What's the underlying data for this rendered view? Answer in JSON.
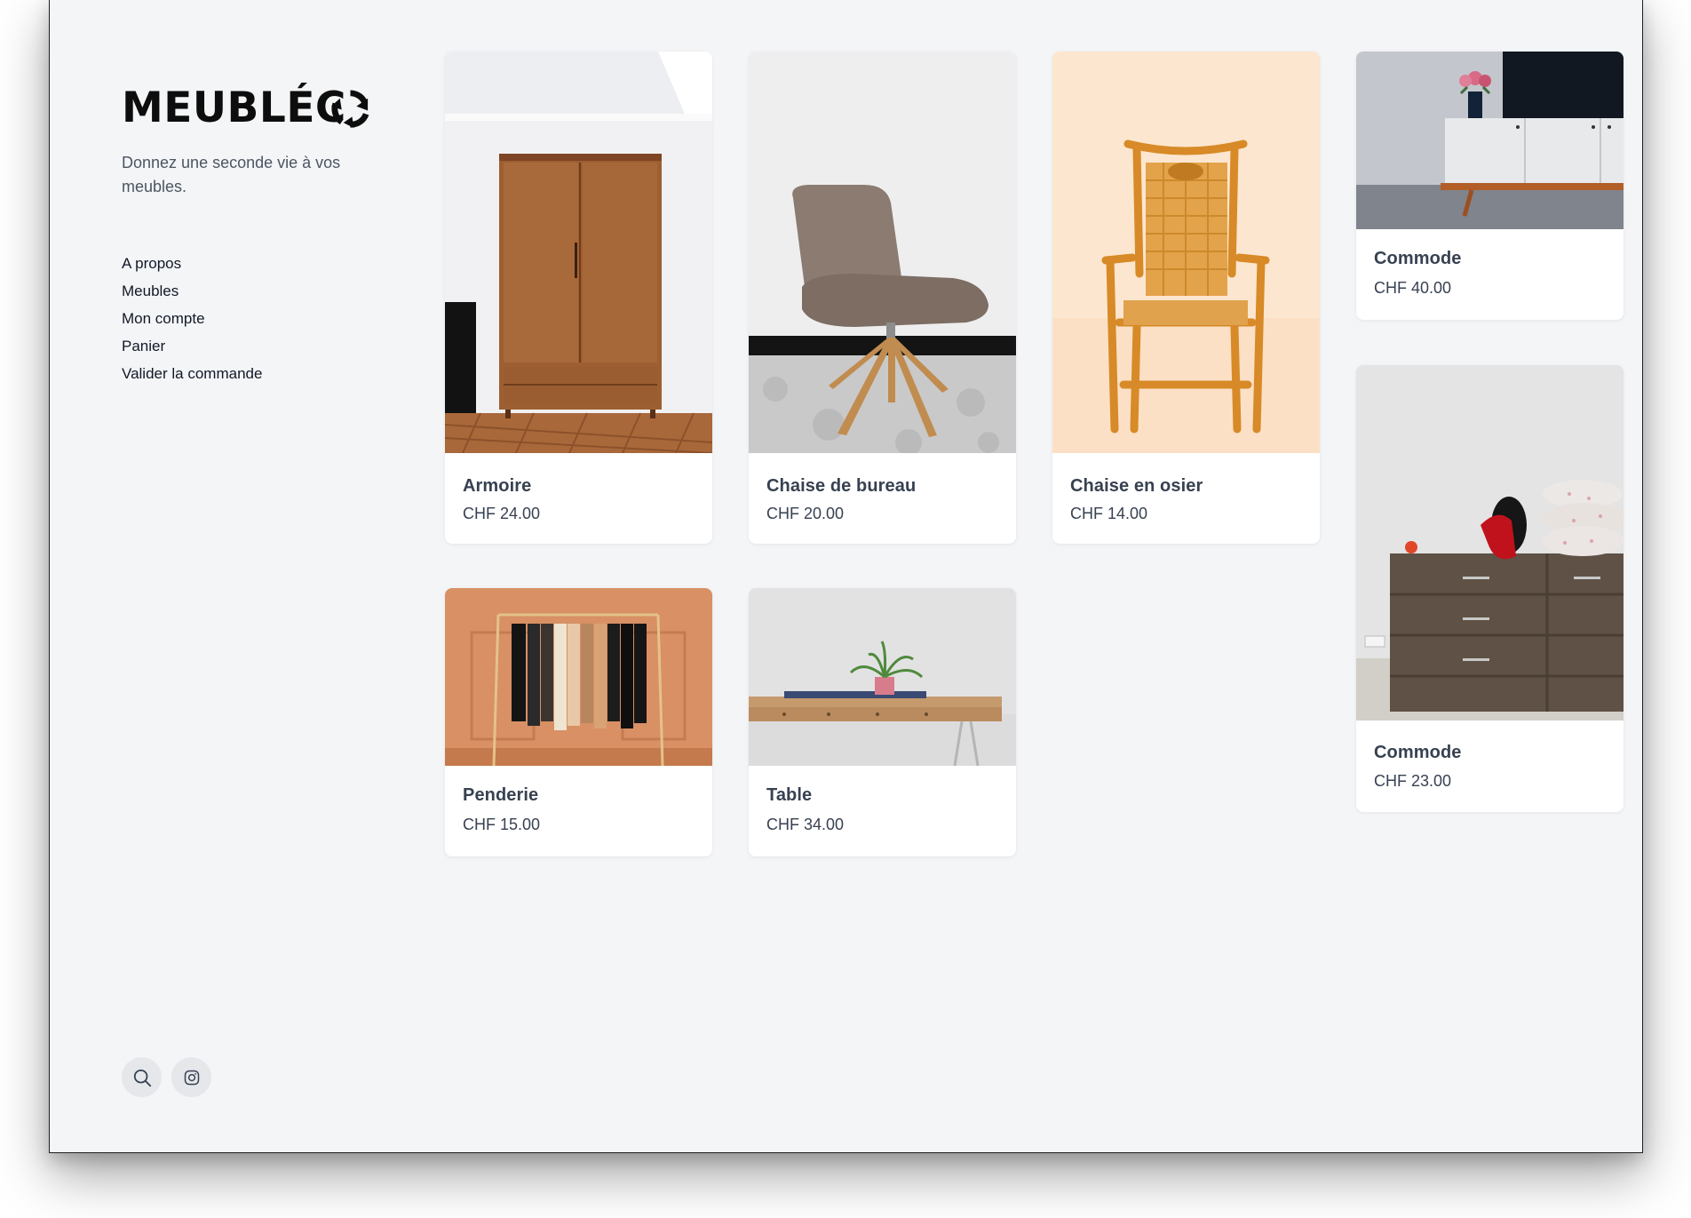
{
  "brand": {
    "name": "MEUBLÉC",
    "logo_icon": "recycle-arrows-icon",
    "tagline": "Donnez une seconde vie à vos meubles."
  },
  "nav": {
    "items": [
      {
        "label": "A propos"
      },
      {
        "label": "Meubles"
      },
      {
        "label": "Mon compte"
      },
      {
        "label": "Panier"
      },
      {
        "label": "Valider la commande"
      }
    ]
  },
  "social": {
    "search_icon": "search-icon",
    "instagram_icon": "instagram-icon"
  },
  "products": [
    {
      "name": "Armoire",
      "price": "CHF 24.00",
      "image": "wooden-wardrobe-photo"
    },
    {
      "name": "Chaise de bureau",
      "price": "CHF 20.00",
      "image": "grey-lounge-chair-photo"
    },
    {
      "name": "Chaise en osier",
      "price": "CHF 14.00",
      "image": "wicker-chair-photo"
    },
    {
      "name": "Commode",
      "price": "CHF 40.00",
      "image": "white-sideboard-photo"
    },
    {
      "name": "Penderie",
      "price": "CHF 15.00",
      "image": "clothes-rack-photo"
    },
    {
      "name": "Table",
      "price": "CHF 34.00",
      "image": "wooden-desk-plant-photo"
    },
    {
      "name": "Commode",
      "price": "CHF 23.00",
      "image": "brown-dresser-pillows-photo"
    }
  ],
  "colors": {
    "background": "#f4f5f7",
    "card": "#ffffff",
    "text": "#374151",
    "muted": "#4b5563"
  }
}
